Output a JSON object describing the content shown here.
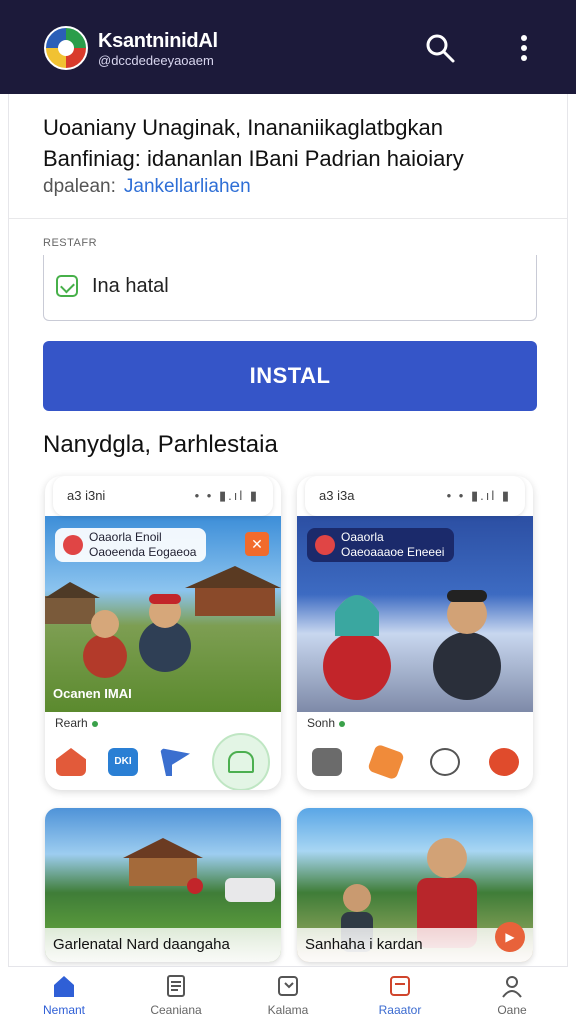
{
  "app": {
    "brand": "KsantninidAl",
    "handle": "@dccdedeeyaoaem"
  },
  "topbar": {
    "search_icon": "search-icon",
    "more_icon": "more-vert-icon"
  },
  "header": {
    "headline": "Uoaniany Unaginak, Inananiikaglatbgkan Banfiniag: idananlan IBani Padrian haioiary",
    "sub_prefix": "dpalean:",
    "sub_link": "Jankellarliahen"
  },
  "form": {
    "label": "RESTAFR",
    "field_value": "Ina hatal",
    "button": "INSTAL"
  },
  "section": {
    "title": "Nanydgla, Parhlestaia"
  },
  "cards": [
    {
      "time": "a3 i3ni",
      "status": "• •  ▮.ıl ▮",
      "overlay": "Oaaorla Enoil\nOaoeenda Eogaeoa",
      "overlay_close": "✕",
      "photo_label": "Ocanen IMAI",
      "caption": "Rearh",
      "icons": [
        "house-icon",
        "chat-icon",
        "flag-icon",
        "bell-icon"
      ],
      "chat_label": "DKI"
    },
    {
      "time": "a3 i3a",
      "status": "• •  ▮.ıl ▮",
      "overlay": "Oaaorla\nOaeoaaaoe Eneeei",
      "caption": "Sonh",
      "icons": [
        "radio-icon",
        "brush-icon",
        "smile-icon",
        "chat-bubble-icon"
      ]
    }
  ],
  "photos": [
    {
      "caption": "Garlenatal Nard daangaha"
    },
    {
      "caption": "Sanhaha i kardan",
      "badge": "▶"
    }
  ],
  "nav": [
    {
      "label": "Nemant",
      "icon": "home-icon",
      "active": true
    },
    {
      "label": "Ceaniana",
      "icon": "document-icon"
    },
    {
      "label": "Kalama",
      "icon": "calendar-icon"
    },
    {
      "label": "Raaator",
      "icon": "report-icon"
    },
    {
      "label": "Oane",
      "icon": "profile-icon"
    }
  ],
  "colors": {
    "topbar": "#1c1a3a",
    "primary_button": "#3555c8",
    "link": "#2f6fd6",
    "accent_orange": "#f26b2c",
    "accent_green": "#4caf50"
  }
}
